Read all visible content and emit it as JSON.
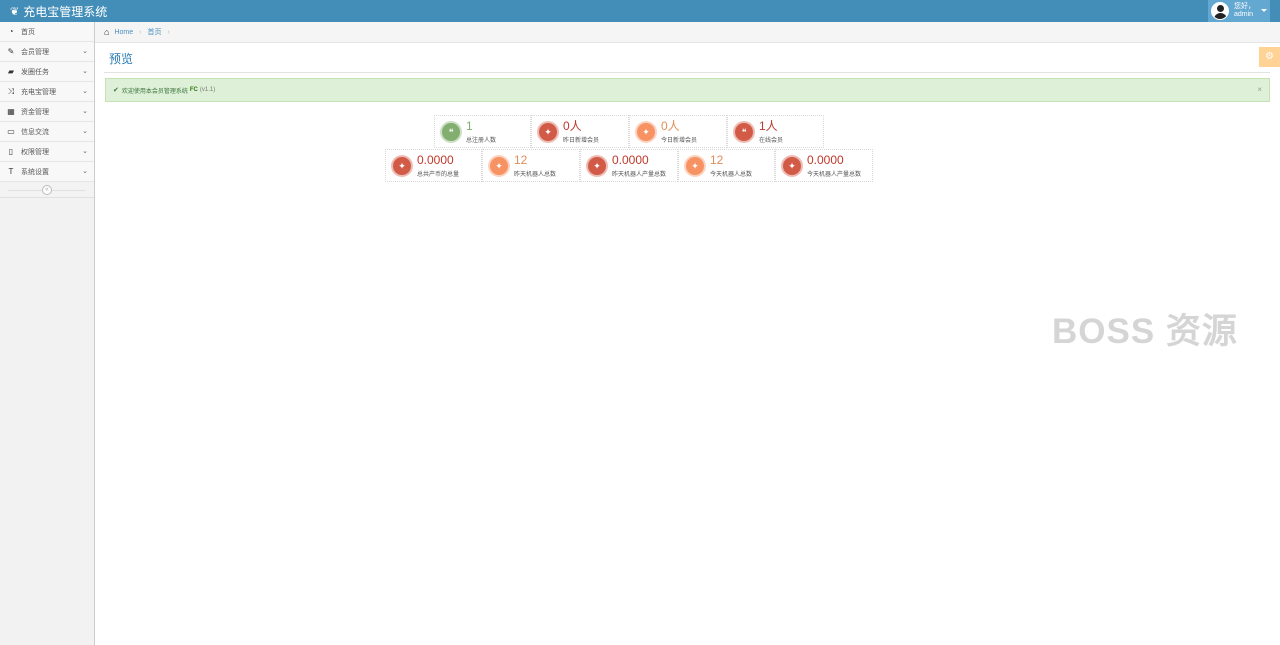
{
  "app": {
    "title": "充电宝管理系统"
  },
  "user": {
    "greeting": "您好，",
    "name": "admin"
  },
  "sidebar": {
    "items": [
      {
        "label": "首页",
        "icon": "dashboard-icon"
      },
      {
        "label": "会员管理",
        "icon": "edit-icon",
        "has_submenu": true
      },
      {
        "label": "发圈任务",
        "icon": "book-icon",
        "has_submenu": true
      },
      {
        "label": "充电宝管理",
        "icon": "random-icon",
        "has_submenu": true
      },
      {
        "label": "资金管理",
        "icon": "calendar-icon",
        "has_submenu": true
      },
      {
        "label": "信息交流",
        "icon": "credit-card-icon",
        "has_submenu": true
      },
      {
        "label": "权限管理",
        "icon": "file-icon",
        "has_submenu": true
      },
      {
        "label": "系统设置",
        "icon": "text-height-icon",
        "has_submenu": true
      }
    ]
  },
  "breadcrumb": {
    "home": "Home",
    "current": "首页"
  },
  "page": {
    "title": "预览"
  },
  "alert": {
    "text": "欢迎使用本会员管理系统",
    "brand": "FC",
    "version": "(v1.1)",
    "close": "×"
  },
  "stats_row1": [
    {
      "value": "1",
      "label": "总注册人数",
      "color": "#82af6f"
    },
    {
      "value": "0人",
      "label": "昨日新增会员",
      "color": "#d15b47"
    },
    {
      "value": "0人",
      "label": "今日新增会员",
      "color": "#f79263"
    },
    {
      "value": "1人",
      "label": "在线会员",
      "color": "#d15b47"
    }
  ],
  "stats_row2": [
    {
      "value": "0.0000",
      "label": "总共产币的总量",
      "color": "#d15b47"
    },
    {
      "value": "12",
      "label": "昨天机器人总数",
      "color": "#f79263"
    },
    {
      "value": "0.0000",
      "label": "昨天机器人产量总数",
      "color": "#d15b47"
    },
    {
      "value": "12",
      "label": "今天机器人总数",
      "color": "#f79263"
    },
    {
      "value": "0.0000",
      "label": "今天机器人产量总数",
      "color": "#d15b47"
    }
  ],
  "watermark": "BOSS 资源"
}
